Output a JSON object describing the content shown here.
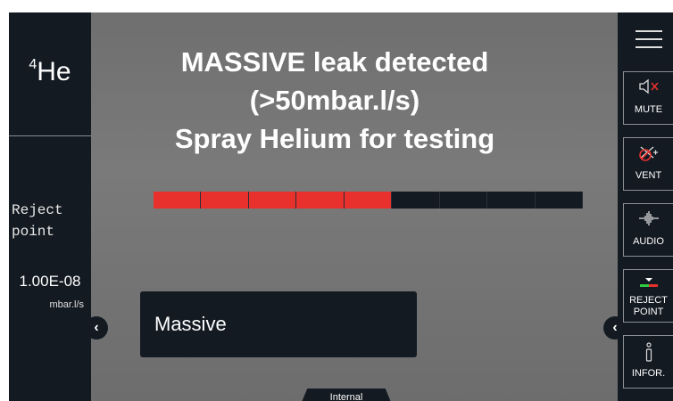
{
  "gas": {
    "mass": "4",
    "symbol": "He"
  },
  "reject": {
    "label": "Reject\npoint",
    "value": "1.00E-08",
    "unit": "mbar.l/s"
  },
  "headline": {
    "line1": "MASSIVE leak detected",
    "line2": "(>50mbar.l/s)",
    "line3": "Spray Helium for testing"
  },
  "leak_bar": {
    "segments": 9,
    "filled_segments": 5,
    "filled_color": "#e8312c",
    "empty_color": "#131a22"
  },
  "message": "Massive",
  "mode_tab": "Internal",
  "right_menu": {
    "buttons": [
      {
        "label": "MUTE",
        "icon": "speaker-muted-icon"
      },
      {
        "label": "VENT",
        "icon": "vent-valve-icon"
      },
      {
        "label": "AUDIO",
        "icon": "audio-wave-icon"
      },
      {
        "label": "REJECT\nPOINT",
        "icon": "reject-point-icon"
      },
      {
        "label": "INFOR.",
        "icon": "info-icon"
      }
    ]
  },
  "colors": {
    "panel": "#131a22",
    "background": "#757575",
    "alert": "#e8312c"
  }
}
